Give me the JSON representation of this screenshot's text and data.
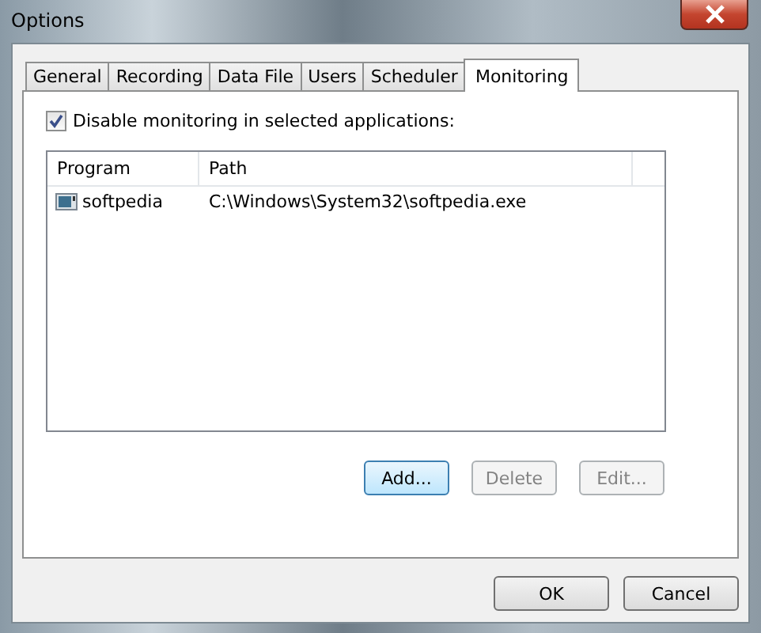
{
  "window": {
    "title": "Options"
  },
  "tabs": [
    {
      "label": "General",
      "selected": false
    },
    {
      "label": "Recording",
      "selected": false
    },
    {
      "label": "Data File",
      "selected": false
    },
    {
      "label": "Users",
      "selected": false
    },
    {
      "label": "Scheduler",
      "selected": false
    },
    {
      "label": "Monitoring",
      "selected": true
    }
  ],
  "monitoring_checkbox": {
    "label": "Disable monitoring in selected applications:",
    "checked": true
  },
  "table": {
    "columns": [
      "Program",
      "Path"
    ],
    "rows": [
      {
        "program": "softpedia",
        "path": "C:\\Windows\\System32\\softpedia.exe"
      }
    ]
  },
  "list_buttons": [
    {
      "label": "Add...",
      "disabled": false,
      "focused": true
    },
    {
      "label": "Delete",
      "disabled": true,
      "focused": false
    },
    {
      "label": "Edit...",
      "disabled": true,
      "focused": false
    }
  ],
  "dialog_buttons": [
    "OK",
    "Cancel"
  ]
}
